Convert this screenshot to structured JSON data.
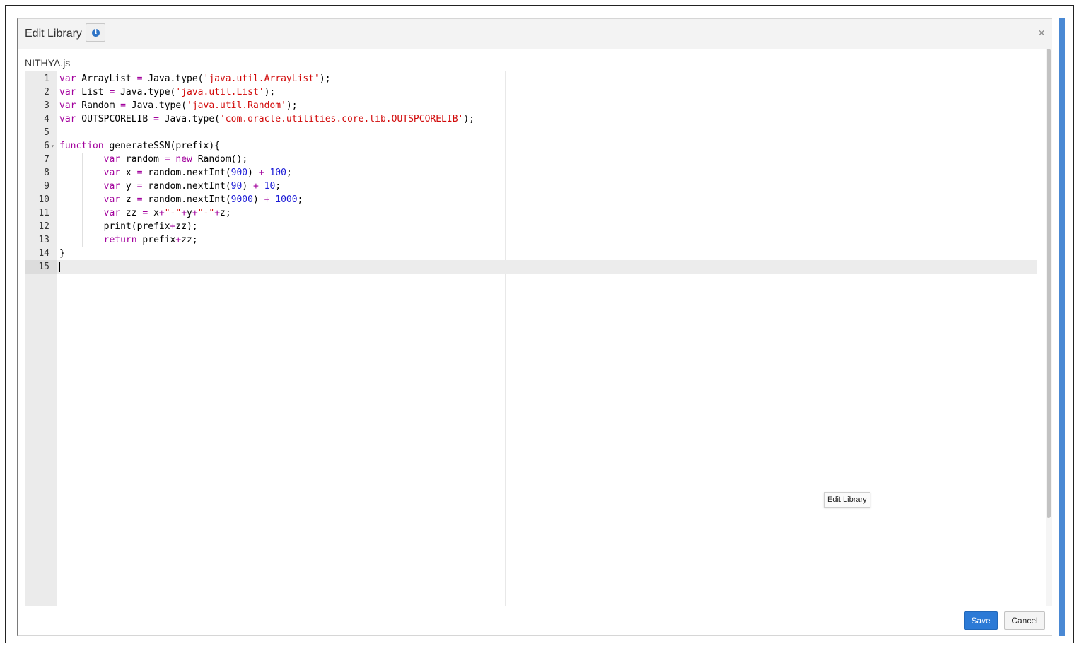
{
  "dialog": {
    "title": "Edit Library",
    "info_icon": "info-icon",
    "close_label": "×",
    "file_name": "NITHYA.js"
  },
  "editor": {
    "lines": [
      {
        "num": "1",
        "tokens": [
          [
            "kw",
            "var"
          ],
          [
            "t",
            " ArrayList "
          ],
          [
            "op",
            "="
          ],
          [
            "t",
            " Java.type("
          ],
          [
            "str",
            "'java.util.ArrayList'"
          ],
          [
            "t",
            ");"
          ]
        ]
      },
      {
        "num": "2",
        "tokens": [
          [
            "kw",
            "var"
          ],
          [
            "t",
            " List "
          ],
          [
            "op",
            "="
          ],
          [
            "t",
            " Java.type("
          ],
          [
            "str",
            "'java.util.List'"
          ],
          [
            "t",
            ");"
          ]
        ]
      },
      {
        "num": "3",
        "tokens": [
          [
            "kw",
            "var"
          ],
          [
            "t",
            " Random "
          ],
          [
            "op",
            "="
          ],
          [
            "t",
            " Java.type("
          ],
          [
            "str",
            "'java.util.Random'"
          ],
          [
            "t",
            ");"
          ]
        ]
      },
      {
        "num": "4",
        "tokens": [
          [
            "kw",
            "var"
          ],
          [
            "t",
            " OUTSPCORELIB "
          ],
          [
            "op",
            "="
          ],
          [
            "t",
            " Java.type("
          ],
          [
            "str",
            "'com.oracle.utilities.core.lib.OUTSPCORELIB'"
          ],
          [
            "t",
            ");"
          ]
        ]
      },
      {
        "num": "5",
        "tokens": []
      },
      {
        "num": "6",
        "fold": true,
        "tokens": [
          [
            "kw",
            "function"
          ],
          [
            "t",
            " generateSSN(prefix){"
          ]
        ]
      },
      {
        "num": "7",
        "tokens": [
          [
            "t",
            "        "
          ],
          [
            "kw",
            "var"
          ],
          [
            "t",
            " random "
          ],
          [
            "op",
            "="
          ],
          [
            "t",
            " "
          ],
          [
            "kw",
            "new"
          ],
          [
            "t",
            " Random();"
          ]
        ]
      },
      {
        "num": "8",
        "tokens": [
          [
            "t",
            "        "
          ],
          [
            "kw",
            "var"
          ],
          [
            "t",
            " x "
          ],
          [
            "op",
            "="
          ],
          [
            "t",
            " random.nextInt("
          ],
          [
            "num",
            "900"
          ],
          [
            "t",
            ") "
          ],
          [
            "op",
            "+"
          ],
          [
            "t",
            " "
          ],
          [
            "num",
            "100"
          ],
          [
            "t",
            ";"
          ]
        ]
      },
      {
        "num": "9",
        "tokens": [
          [
            "t",
            "        "
          ],
          [
            "kw",
            "var"
          ],
          [
            "t",
            " y "
          ],
          [
            "op",
            "="
          ],
          [
            "t",
            " random.nextInt("
          ],
          [
            "num",
            "90"
          ],
          [
            "t",
            ") "
          ],
          [
            "op",
            "+"
          ],
          [
            "t",
            " "
          ],
          [
            "num",
            "10"
          ],
          [
            "t",
            ";"
          ]
        ]
      },
      {
        "num": "10",
        "tokens": [
          [
            "t",
            "        "
          ],
          [
            "kw",
            "var"
          ],
          [
            "t",
            " z "
          ],
          [
            "op",
            "="
          ],
          [
            "t",
            " random.nextInt("
          ],
          [
            "num",
            "9000"
          ],
          [
            "t",
            ") "
          ],
          [
            "op",
            "+"
          ],
          [
            "t",
            " "
          ],
          [
            "num",
            "1000"
          ],
          [
            "t",
            ";"
          ]
        ]
      },
      {
        "num": "11",
        "tokens": [
          [
            "t",
            "        "
          ],
          [
            "kw",
            "var"
          ],
          [
            "t",
            " zz "
          ],
          [
            "op",
            "="
          ],
          [
            "t",
            " x"
          ],
          [
            "op",
            "+"
          ],
          [
            "str",
            "\"-\""
          ],
          [
            "op",
            "+"
          ],
          [
            "t",
            "y"
          ],
          [
            "op",
            "+"
          ],
          [
            "str",
            "\"-\""
          ],
          [
            "op",
            "+"
          ],
          [
            "t",
            "z;"
          ]
        ]
      },
      {
        "num": "12",
        "tokens": [
          [
            "t",
            "        print(prefix"
          ],
          [
            "op",
            "+"
          ],
          [
            "t",
            "zz);"
          ]
        ]
      },
      {
        "num": "13",
        "tokens": [
          [
            "t",
            "        "
          ],
          [
            "kw",
            "return"
          ],
          [
            "t",
            " prefix"
          ],
          [
            "op",
            "+"
          ],
          [
            "t",
            "zz;"
          ]
        ]
      },
      {
        "num": "14",
        "tokens": [
          [
            "t",
            "}"
          ]
        ]
      },
      {
        "num": "15",
        "active": true,
        "tokens": []
      }
    ]
  },
  "tooltip": {
    "text": "Edit Library"
  },
  "footer": {
    "save_label": "Save",
    "cancel_label": "Cancel"
  },
  "colors": {
    "accent": "#2c7ad6",
    "keyword": "#a2009c",
    "string": "#d10a0a",
    "number": "#1a1ad6"
  }
}
